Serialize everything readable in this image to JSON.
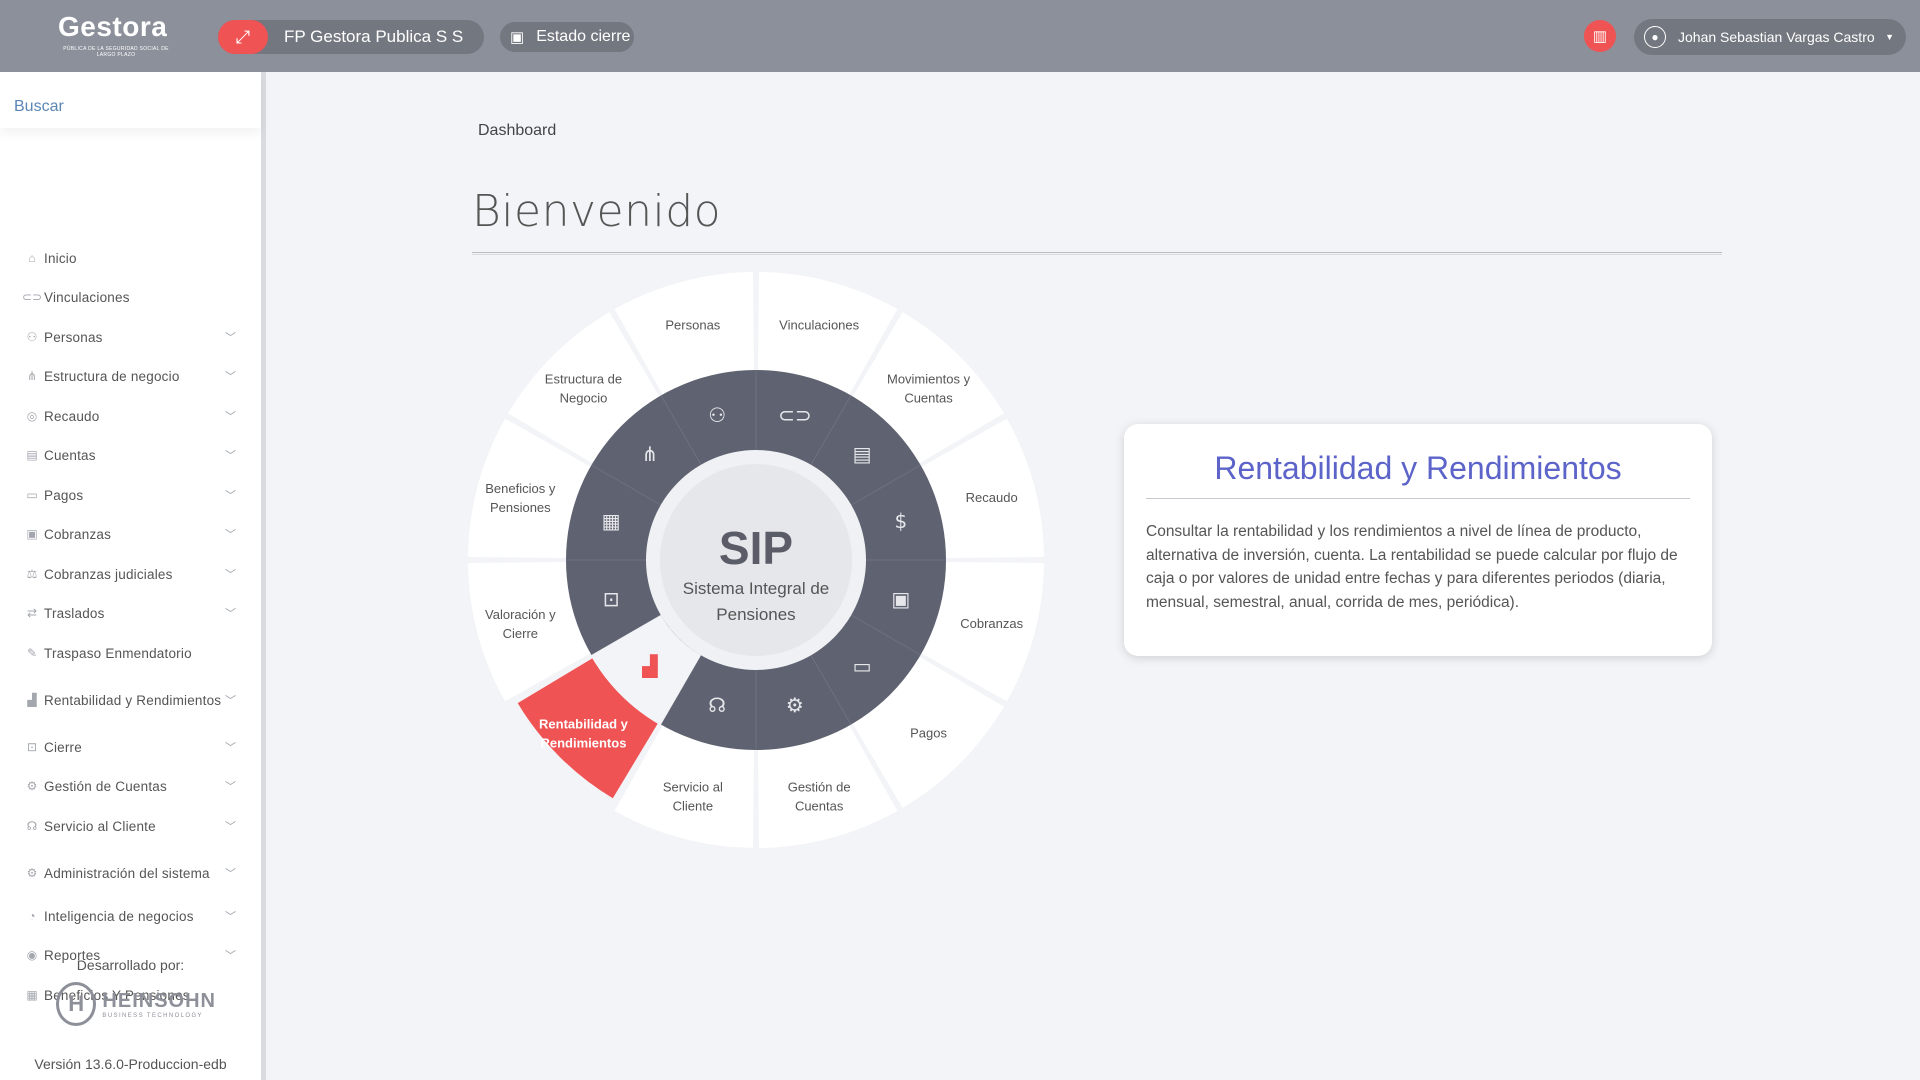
{
  "header": {
    "logo_text": "Gestora",
    "logo_subtitle": "PÚBLICA DE LA SEGURIDAD SOCIAL DE LARGO PLAZO",
    "entity_name": "FP Gestora Publica S S",
    "status_label": "Estado cierre",
    "user_name": "Johan Sebastian Vargas Castro",
    "icons": {
      "entity": "swap-arrows-icon",
      "status": "calendar-icon",
      "notifications": "book-icon",
      "user": "user-icon",
      "caret": "caret-down-icon"
    }
  },
  "sidebar": {
    "search_placeholder": "Buscar",
    "items": [
      {
        "label": "Inicio",
        "icon": "home-icon",
        "chevron": ""
      },
      {
        "label": "Vinculaciones",
        "icon": "link-icon",
        "chevron": ""
      },
      {
        "label": "Personas",
        "icon": "people-icon",
        "chevron": "﹀"
      },
      {
        "label": "Estructura de negocio",
        "icon": "hierarchy-icon",
        "chevron": "﹀"
      },
      {
        "label": "Recaudo",
        "icon": "coin-icon",
        "chevron": "﹀"
      },
      {
        "label": "Cuentas",
        "icon": "accounts-icon",
        "chevron": "﹀"
      },
      {
        "label": "Pagos",
        "icon": "payment-icon",
        "chevron": "﹀"
      },
      {
        "label": "Cobranzas",
        "icon": "briefcase-icon",
        "chevron": "﹀"
      },
      {
        "label": "Cobranzas judiciales",
        "icon": "gavel-icon",
        "chevron": "﹀"
      },
      {
        "label": "Traslados",
        "icon": "transfer-icon",
        "chevron": "﹀"
      },
      {
        "label": "Traspaso Enmendatorio",
        "icon": "amend-icon",
        "chevron": ""
      },
      {
        "label": "Rentabilidad y Rendimientos",
        "icon": "chart-icon",
        "chevron": "﹀"
      },
      {
        "label": "Cierre",
        "icon": "lock-icon",
        "chevron": "﹀"
      },
      {
        "label": "Gestión de Cuentas",
        "icon": "user-gear-icon",
        "chevron": "﹀"
      },
      {
        "label": "Servicio al Cliente",
        "icon": "headset-icon",
        "chevron": "﹀"
      },
      {
        "label": "Administración del sistema",
        "icon": "settings-icon",
        "chevron": "﹀"
      },
      {
        "label": "Inteligencia de negocios",
        "icon": "dashboard-icon",
        "chevron": "﹀"
      },
      {
        "label": "Reportes",
        "icon": "report-icon",
        "chevron": "﹀"
      },
      {
        "label": "Beneficios Y Pensiones",
        "icon": "benefits-icon",
        "chevron": ""
      }
    ],
    "developed_by": "Desarrollado por:",
    "company_name": "HEINSOHN",
    "company_tagline": "BUSINESS TECHNOLOGY",
    "version": "Versión 13.6.0-Produccion-edb"
  },
  "main": {
    "breadcrumb": "Dashboard",
    "title": "Bienvenido",
    "wheel": {
      "center_title": "SIP",
      "center_subtitle_line1": "Sistema Integral de",
      "center_subtitle_line2": "Pensiones",
      "active_color": "#ef5353",
      "ring_color": "#5f6270",
      "segments": [
        {
          "line1": "Vinculaciones",
          "line2": "",
          "icon": "link-icon"
        },
        {
          "line1": "Movimientos y",
          "line2": "Cuentas",
          "icon": "ledger-icon"
        },
        {
          "line1": "Recaudo",
          "line2": "",
          "icon": "coin-icon"
        },
        {
          "line1": "Cobranzas",
          "line2": "",
          "icon": "briefcase-icon"
        },
        {
          "line1": "Pagos",
          "line2": "",
          "icon": "payment-icon"
        },
        {
          "line1": "Gestión de",
          "line2": "Cuentas",
          "icon": "user-gear-icon"
        },
        {
          "line1": "Servicio al",
          "line2": "Cliente",
          "icon": "headset-icon"
        },
        {
          "line1": "Rentabilidad y",
          "line2": "Rendimientos",
          "icon": "chart-icon",
          "active": true
        },
        {
          "line1": "Valoración y",
          "line2": "Cierre",
          "icon": "lock-icon"
        },
        {
          "line1": "Beneficios y",
          "line2": "Pensiones",
          "icon": "benefits-icon"
        },
        {
          "line1": "Estructura de",
          "line2": "Negocio",
          "icon": "hierarchy-icon"
        },
        {
          "line1": "Personas",
          "line2": "",
          "icon": "people-icon"
        }
      ]
    },
    "info_card": {
      "title": "Rentabilidad y Rendimientos",
      "description": "Consultar la rentabilidad y los rendimientos a nivel de línea de producto, alternativa de inversión, cuenta. La rentabilidad se puede calcular por flujo de caja o por valores de unidad entre fechas y para diferentes periodos (diaria, mensual, semestral, anual, corrida de mes, periódica)."
    }
  }
}
